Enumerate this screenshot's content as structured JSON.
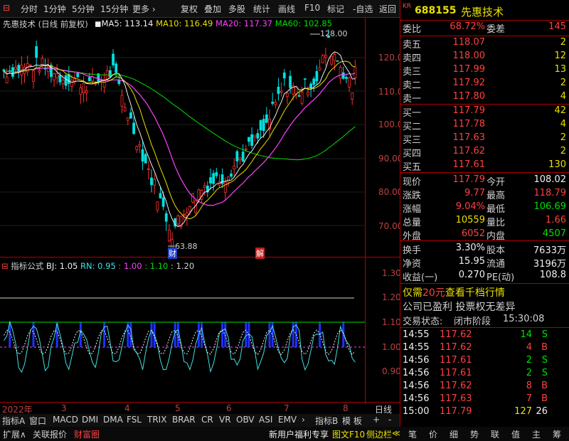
{
  "toolbar": {
    "left_items": [
      "分时",
      "1分钟",
      "5分钟",
      "15分钟",
      "更多"
    ],
    "right_items": [
      "复权",
      "叠加",
      "多股",
      "统计",
      "画线",
      "F10",
      "标记",
      "-自选",
      "返回"
    ]
  },
  "chart_header": {
    "title": "先惠技术 (日线 前复权)",
    "ma5": "MA5: 113.14",
    "ma10": "MA10: 116.49",
    "ma20": "MA20: 117.37",
    "ma60": "MA60: 102.85"
  },
  "price_axis": [
    "120.0",
    "110.0",
    "100.0",
    "90.00",
    "80.00",
    "70.00"
  ],
  "annotations": {
    "high": "128.00",
    "low": "63.88",
    "cai": "财",
    "jie": "解"
  },
  "indicator": {
    "name": "指标公式",
    "bj": "BJ: 1.05",
    "rn": "RN: 0.95",
    "v1": ": 1.00",
    "v2": ": 1.10",
    "v3": ": 1.20",
    "axis": [
      "1.30",
      "1.20",
      "1.10",
      "1.00",
      "0.90"
    ]
  },
  "date_axis": {
    "labels": [
      "2022年",
      "3",
      "4",
      "5",
      "6",
      "7",
      "8"
    ],
    "right_label": "日线"
  },
  "bottom_tabs": [
    "指标A",
    "窗口",
    "MACD",
    "DMI",
    "DMA",
    "FSL",
    "TRIX",
    "BRAR",
    "CR",
    "VR",
    "OBV",
    "ASI",
    "EMV",
    "›",
    "指标B",
    "模 板",
    "+",
    "-"
  ],
  "bottom_bar": {
    "left": [
      "扩展∧",
      "关联报价",
      "财富圈"
    ],
    "promo": "新用户福利专享",
    "right": [
      "图文F10",
      "侧边栏",
      "≪"
    ]
  },
  "quote": {
    "market": "KR",
    "code": "688155",
    "name": "先惠技术",
    "weibi_label": "委比",
    "weibi": "68.72%",
    "weicha_label": "委差",
    "weicha": "145",
    "sells": [
      {
        "label": "卖五",
        "price": "118.07",
        "vol": "2"
      },
      {
        "label": "卖四",
        "price": "118.00",
        "vol": "12"
      },
      {
        "label": "卖三",
        "price": "117.99",
        "vol": "13"
      },
      {
        "label": "卖二",
        "price": "117.92",
        "vol": "2"
      },
      {
        "label": "卖一",
        "price": "117.80",
        "vol": "4"
      }
    ],
    "buys": [
      {
        "label": "买一",
        "price": "117.79",
        "vol": "42"
      },
      {
        "label": "买二",
        "price": "117.78",
        "vol": "4"
      },
      {
        "label": "买三",
        "price": "117.63",
        "vol": "2"
      },
      {
        "label": "买四",
        "price": "117.62",
        "vol": "2"
      },
      {
        "label": "买五",
        "price": "117.61",
        "vol": "130"
      }
    ],
    "stats": [
      {
        "l1": "现价",
        "v1": "117.79",
        "c1": "red",
        "l2": "今开",
        "v2": "108.02",
        "c2": "white"
      },
      {
        "l1": "涨跌",
        "v1": "9.77",
        "c1": "red",
        "l2": "最高",
        "v2": "118.79",
        "c2": "red"
      },
      {
        "l1": "涨幅",
        "v1": "9.04%",
        "c1": "red",
        "l2": "最低",
        "v2": "106.69",
        "c2": "green"
      },
      {
        "l1": "总量",
        "v1": "10559",
        "c1": "yellow",
        "l2": "量比",
        "v2": "1.66",
        "c2": "red"
      },
      {
        "l1": "外盘",
        "v1": "6052",
        "c1": "red",
        "l2": "内盘",
        "v2": "4507",
        "c2": "green"
      }
    ],
    "stats2": [
      {
        "l1": "换手",
        "v1": "3.30%",
        "l2": "股本",
        "v2": "7633万"
      },
      {
        "l1": "净资",
        "v1": "15.95",
        "l2": "流通",
        "v2": "3196万"
      },
      {
        "l1": "收益(一)",
        "v1": "0.270",
        "l2": "PE(动)",
        "v2": "108.8"
      }
    ],
    "promo_prefix": "仅需",
    "promo_price": "20元",
    "promo_suffix": "查看千档行情",
    "info": "公司已盈利 投票权无差异",
    "status_label": "交易状态:",
    "status": "闭市阶段",
    "status_time": "15:30:08",
    "ticks": [
      {
        "time": "14:55",
        "price": "117.62",
        "vol": "14",
        "side": "S"
      },
      {
        "time": "14:55",
        "price": "117.62",
        "vol": "4",
        "side": "B"
      },
      {
        "time": "14:56",
        "price": "117.61",
        "vol": "2",
        "side": "S"
      },
      {
        "time": "14:56",
        "price": "117.61",
        "vol": "2",
        "side": "S"
      },
      {
        "time": "14:56",
        "price": "117.62",
        "vol": "8",
        "side": "B"
      },
      {
        "time": "14:56",
        "price": "117.63",
        "vol": "7",
        "side": "B"
      },
      {
        "time": "15:00",
        "price": "117.79",
        "vol": "127",
        "side": "26"
      }
    ],
    "bottom_tabs": [
      "笔",
      "价",
      "细",
      "势",
      "联",
      "值",
      "主",
      "筹"
    ]
  },
  "colors": {
    "up": "#ff3030",
    "down": "#00e0e0",
    "ma5": "#ffffff",
    "ma10": "#e8e000",
    "ma20": "#ff40ff",
    "ma60": "#00e000",
    "frame": "#b00000"
  }
}
